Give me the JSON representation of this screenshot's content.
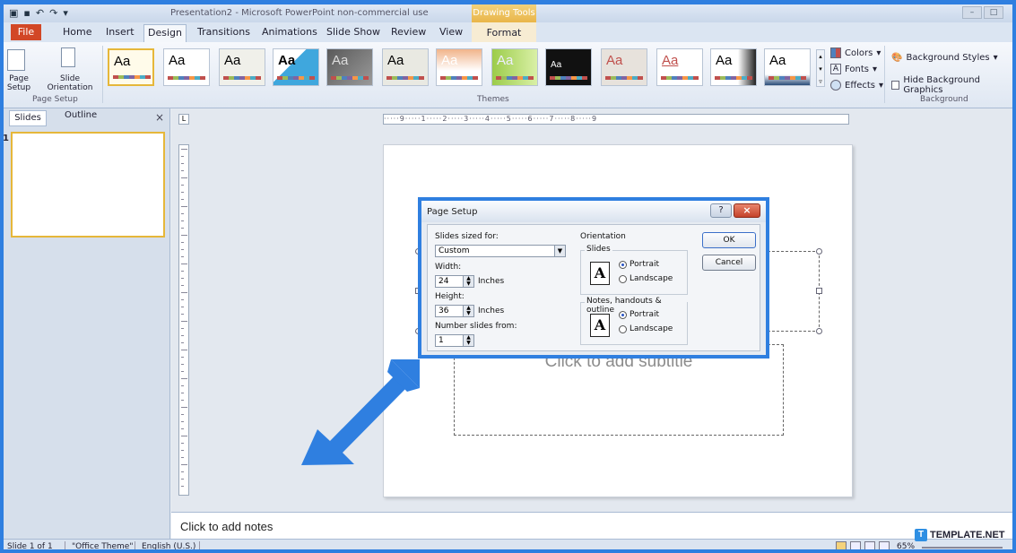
{
  "titlebar": {
    "title": "Presentation2 - Microsoft PowerPoint non-commercial use",
    "context_group": "Drawing Tools"
  },
  "tabs": {
    "file": "File",
    "items": [
      "Home",
      "Insert",
      "Design",
      "Transitions",
      "Animations",
      "Slide Show",
      "Review",
      "View"
    ],
    "active": "Design",
    "format": "Format"
  },
  "ribbon": {
    "page_setup": {
      "btn1": "Page Setup",
      "btn2": "Slide Orientation",
      "label": "Page Setup"
    },
    "themes": {
      "label": "Themes",
      "sample": "Aa"
    },
    "variants": {
      "colors": "Colors",
      "fonts": "Fonts",
      "effects": "Effects"
    },
    "background": {
      "styles": "Background Styles",
      "hide": "Hide Background Graphics",
      "label": "Background"
    }
  },
  "leftpane": {
    "tab_slides": "Slides",
    "tab_outline": "Outline",
    "close": "×",
    "slide_number": "1"
  },
  "slide": {
    "subtitle_placeholder": "Click to add subtitle"
  },
  "notes": {
    "placeholder": "Click to add notes"
  },
  "statusbar": {
    "slide_info": "Slide 1 of 1",
    "theme": "\"Office Theme\"",
    "language": "English (U.S.)",
    "zoom": "65%"
  },
  "dialog": {
    "title": "Page Setup",
    "help": "?",
    "close": "×",
    "slides_sized_for_label": "Slides sized for:",
    "slides_sized_for_value": "Custom",
    "width_label": "Width:",
    "width_value": "24",
    "height_label": "Height:",
    "height_value": "36",
    "units": "Inches",
    "number_from_label": "Number slides from:",
    "number_from_value": "1",
    "orientation_label": "Orientation",
    "slides_group": "Slides",
    "notes_group": "Notes, handouts & outline",
    "portrait": "Portrait",
    "landscape": "Landscape",
    "ok": "OK",
    "cancel": "Cancel"
  },
  "watermark": {
    "logo_letter": "T",
    "text": "TEMPLATE.NET"
  },
  "colors": {
    "accent_blue": "#2f7fe0",
    "file_tab": "#d24726",
    "selection": "#e6b73a"
  }
}
